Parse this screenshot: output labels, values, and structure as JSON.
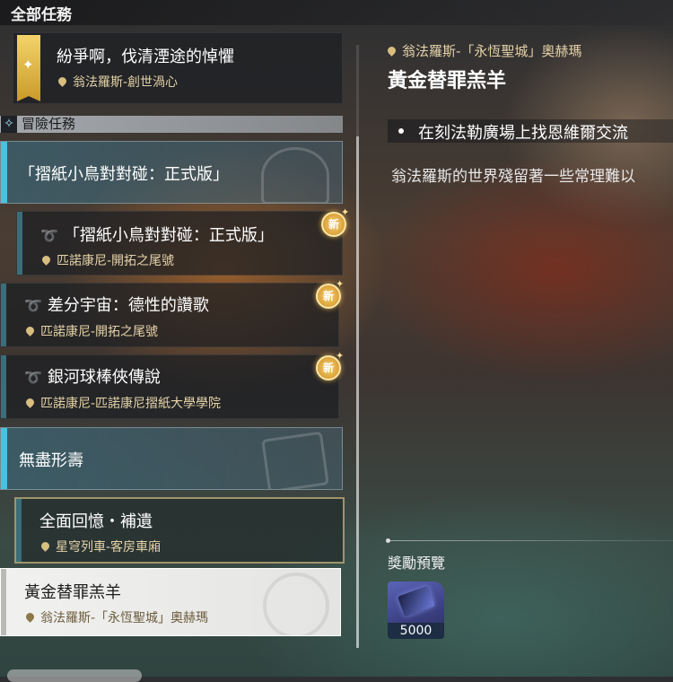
{
  "header": {
    "title": "全部任務"
  },
  "top_card": {
    "title": "紛爭啊，伐清湮途的悼懼",
    "location": "翁法羅斯-創世渦心"
  },
  "section": {
    "title": "冒險任務"
  },
  "quests": [
    {
      "title": "「摺紙小鳥對對碰：正式版」",
      "type": "group"
    },
    {
      "title": "「摺紙小鳥對對碰：正式版」",
      "location": "匹諾康尼-開拓之尾號",
      "badge": "新"
    },
    {
      "title": "差分宇宙：德性的讚歌",
      "location": "匹諾康尼-開拓之尾號",
      "badge": "新"
    },
    {
      "title": "銀河球棒俠傳說",
      "location": "匹諾康尼-匹諾康尼摺紙大學學院",
      "badge": "新"
    },
    {
      "title": "無盡形壽",
      "type": "group"
    },
    {
      "title": "全面回憶・補遺",
      "location": "星穹列車-客房車廂"
    },
    {
      "title": "黃金替罪羔羊",
      "location": "翁法羅斯-「永恆聖城」奧赫瑪",
      "selected": true
    }
  ],
  "detail": {
    "location": "翁法羅斯-「永恆聖城」奧赫瑪",
    "title": "黃金替罪羔羊",
    "objective": "在刻法勒廣場上找恩維爾交流",
    "description": "翁法羅斯的世界殘留著一些常理難以"
  },
  "rewards": {
    "title": "獎勵預覽",
    "items": [
      {
        "icon": "light-cone-card-icon",
        "count": "5000"
      }
    ]
  },
  "colors": {
    "accent_cyan": "#4ac2dd",
    "badge_gold": "#e2a940",
    "location_text": "#e5d3a8",
    "selected_bg": "#e9e9e7"
  }
}
